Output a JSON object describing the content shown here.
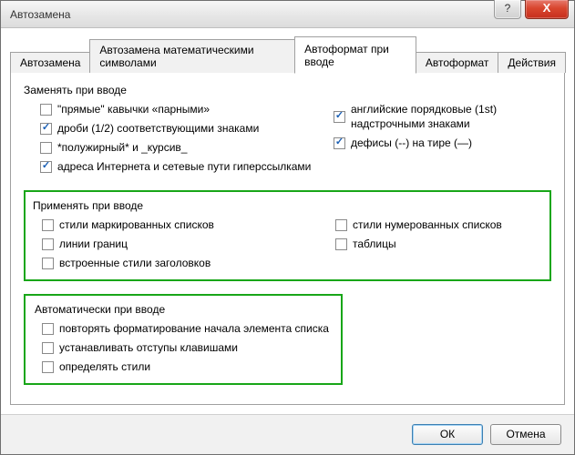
{
  "window": {
    "title": "Автозамена"
  },
  "titlebar": {
    "help": "?",
    "close": "X"
  },
  "tabs": [
    {
      "label": "Автозамена",
      "active": false
    },
    {
      "label": "Автозамена математическими символами",
      "active": false
    },
    {
      "label": "Автоформат при вводе",
      "active": true
    },
    {
      "label": "Автоформат",
      "active": false
    },
    {
      "label": "Действия",
      "active": false
    }
  ],
  "replace_section": {
    "title": "Заменять при вводе",
    "left": [
      {
        "label": "\"прямые\" кавычки «парными»",
        "checked": false
      },
      {
        "label": "дроби (1/2) соответствующими знаками",
        "checked": true
      },
      {
        "label": "*полужирный* и _курсив_",
        "checked": false
      },
      {
        "label": "адреса Интернета и сетевые пути гиперссылками",
        "checked": true
      }
    ],
    "right": [
      {
        "label": "английские порядковые (1st) надстрочными знаками",
        "checked": true
      },
      {
        "label": "дефисы (--) на тире (—)",
        "checked": true
      }
    ]
  },
  "apply_section": {
    "title": "Применять при вводе",
    "left": [
      {
        "label": "стили маркированных списков",
        "checked": false
      },
      {
        "label": "линии границ",
        "checked": false
      },
      {
        "label": "встроенные стили заголовков",
        "checked": false
      }
    ],
    "right": [
      {
        "label": "стили нумерованных списков",
        "checked": false
      },
      {
        "label": "таблицы",
        "checked": false
      }
    ]
  },
  "auto_section": {
    "title": "Автоматически при вводе",
    "items": [
      {
        "label": "повторять форматирование начала элемента списка",
        "checked": false
      },
      {
        "label": "устанавливать отступы клавишами",
        "checked": false
      },
      {
        "label": "определять стили",
        "checked": false
      }
    ]
  },
  "buttons": {
    "ok": "ОК",
    "cancel": "Отмена"
  }
}
